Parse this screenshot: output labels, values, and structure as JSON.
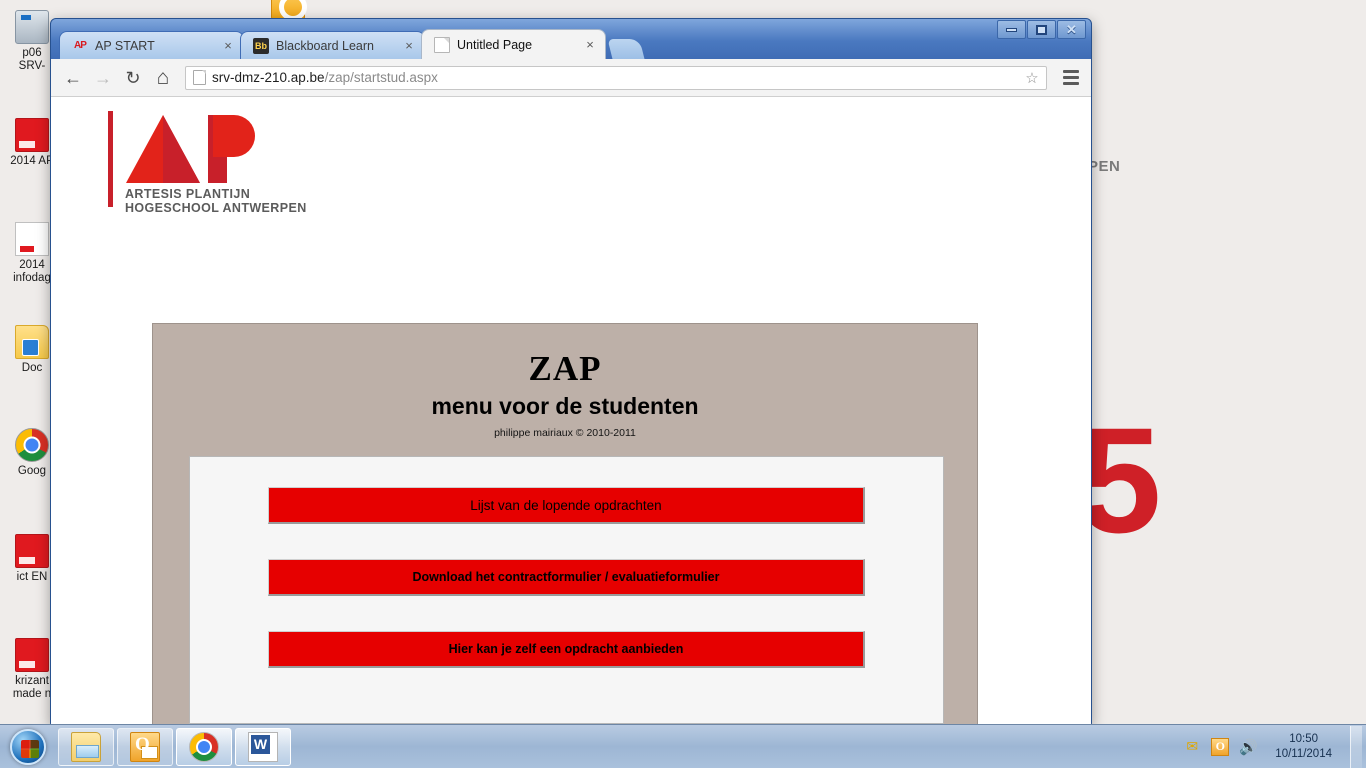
{
  "desktop": {
    "wallpaper": {
      "partial_text": "PEN",
      "big_numeral": "5"
    },
    "icons": [
      {
        "label": "p06\nSRV-",
        "icon": "computer-icon",
        "type": "pc"
      },
      {
        "label": "2014 AP",
        "icon": "pdf-file-icon",
        "type": "pdf"
      },
      {
        "label": "2014\ninfodag",
        "icon": "document-file-icon",
        "type": "doc"
      },
      {
        "label": "Doc",
        "icon": "folder-icon",
        "type": "folder"
      },
      {
        "label": "Goog",
        "icon": "chrome-shortcut-icon",
        "type": "chrome"
      },
      {
        "label": "ict EN",
        "icon": "pdf-file-icon",
        "type": "pdf"
      },
      {
        "label": "krizant\nmade n",
        "icon": "pdf-file-icon",
        "type": "pdf"
      }
    ],
    "top_icon": {
      "icon": "orange-app-icon"
    }
  },
  "browser": {
    "window_controls": {
      "minimize": "–",
      "maximize": "□",
      "close": "✕"
    },
    "tabs": [
      {
        "title": "AP START",
        "favicon": "ap-logo-favicon",
        "favicon_text": "AP",
        "active": false,
        "close": "×"
      },
      {
        "title": "Blackboard Learn",
        "favicon": "blackboard-favicon",
        "favicon_text": "Bb",
        "active": false,
        "close": "×"
      },
      {
        "title": "Untitled Page",
        "favicon": "page-favicon",
        "favicon_text": "",
        "active": true,
        "close": "×"
      }
    ],
    "toolbar": {
      "back": "←",
      "forward": "→",
      "reload": "↻",
      "home": "⌂",
      "star": "☆",
      "url_bold": "srv-dmz-210.ap.be",
      "url_rest": "/zap/startstud.aspx"
    }
  },
  "page": {
    "logo": {
      "alt": "AP",
      "wordmark": "ARTESIS PLANTIJN\nHOGESCHOOL ANTWERPEN"
    },
    "title": "ZAP",
    "subtitle": "menu voor de studenten",
    "credit": "philippe mairiaux © 2010-2011",
    "buttons": [
      {
        "label": "Lijst van de lopende opdrachten"
      },
      {
        "label": "Download het contractformulier / evaluatieformulier"
      },
      {
        "label": "Hier kan je zelf een opdracht aanbieden"
      }
    ],
    "colors": {
      "button_red": "#e60000",
      "outer_panel": "#bdb0a8",
      "inner_panel": "#f6f6f6",
      "logo_red": "#e2231a"
    }
  },
  "taskbar": {
    "start": "start-orb",
    "pinned": [
      {
        "name": "explorer",
        "icon": "windows-explorer-icon"
      },
      {
        "name": "outlook",
        "icon": "outlook-icon"
      },
      {
        "name": "chrome",
        "icon": "chrome-icon",
        "active": true
      },
      {
        "name": "word",
        "icon": "word-icon",
        "active": true
      }
    ],
    "tray": [
      {
        "name": "mail",
        "icon": "envelope-icon",
        "glyph": "✉"
      },
      {
        "name": "outlook",
        "icon": "outlook-tray-icon",
        "glyph": "O"
      },
      {
        "name": "volume",
        "icon": "speaker-icon",
        "glyph": "🔊"
      }
    ],
    "clock": {
      "time": "10:50",
      "date": "10/11/2014"
    }
  }
}
